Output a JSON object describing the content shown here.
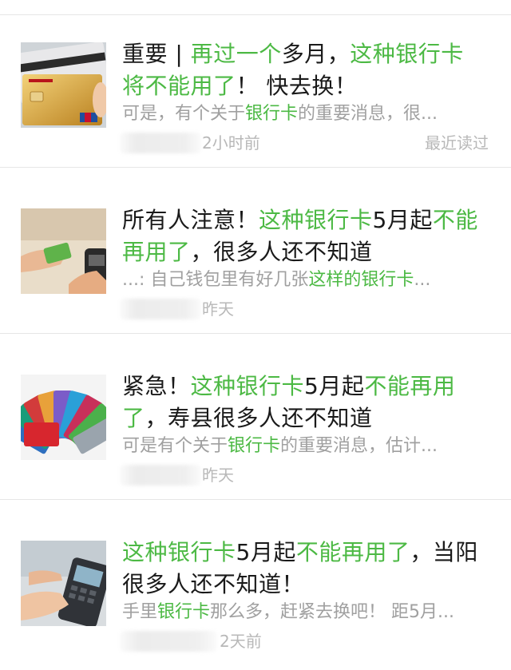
{
  "articles": [
    {
      "title_parts": [
        {
          "text": "重要 | ",
          "hl": false
        },
        {
          "text": "再过一个",
          "hl": true
        },
        {
          "text": "多月，",
          "hl": false
        },
        {
          "text": "这种银行卡将不能用了",
          "hl": true
        },
        {
          "text": "！ 快去换！",
          "hl": false
        }
      ],
      "digest_parts": [
        {
          "text": "可是，有个关于",
          "hl": false
        },
        {
          "text": "银行卡",
          "hl": true
        },
        {
          "text": "的重要消息，很...",
          "hl": false
        }
      ],
      "time": "2小时前",
      "read_status": "最近读过",
      "thumbnail_icon": "bank-card-image-icon"
    },
    {
      "title_parts": [
        {
          "text": "所有人注意！",
          "hl": false
        },
        {
          "text": "这种银行卡",
          "hl": true
        },
        {
          "text": "5月起",
          "hl": false
        },
        {
          "text": "不能再用了",
          "hl": true
        },
        {
          "text": "，很多人还不知道",
          "hl": false
        }
      ],
      "digest_parts": [
        {
          "text": "...: 自己钱包里有好几张",
          "hl": false
        },
        {
          "text": "这样的银行卡",
          "hl": true
        },
        {
          "text": "...",
          "hl": false
        }
      ],
      "time": "昨天",
      "read_status": "",
      "thumbnail_icon": "card-payment-image-icon"
    },
    {
      "title_parts": [
        {
          "text": "紧急！",
          "hl": false
        },
        {
          "text": "这种银行卡",
          "hl": true
        },
        {
          "text": "5月起",
          "hl": false
        },
        {
          "text": "不能再用了",
          "hl": true
        },
        {
          "text": "，寿县很多人还不知道",
          "hl": false
        }
      ],
      "digest_parts": [
        {
          "text": "可是有个关于",
          "hl": false
        },
        {
          "text": "银行卡",
          "hl": true
        },
        {
          "text": "的重要消息，估计...",
          "hl": false
        }
      ],
      "time": "昨天",
      "read_status": "",
      "thumbnail_icon": "card-fan-image-icon"
    },
    {
      "title_parts": [
        {
          "text": "这种银行卡",
          "hl": true
        },
        {
          "text": "5月起",
          "hl": false
        },
        {
          "text": "不能再用了",
          "hl": true
        },
        {
          "text": "，当阳很多人还不知道！",
          "hl": false
        }
      ],
      "digest_parts": [
        {
          "text": "手里",
          "hl": false
        },
        {
          "text": "银行卡",
          "hl": true
        },
        {
          "text": "那么多，赶紧去换吧！ 距5月...",
          "hl": false
        }
      ],
      "time": "2天前",
      "read_status": "",
      "thumbnail_icon": "pos-terminal-image-icon"
    }
  ],
  "colors": {
    "highlight": "#4cb944",
    "title": "#1a1a1a",
    "digest": "#a0a0a0",
    "meta": "#b8b8b8",
    "divider": "#e6e6e6"
  }
}
